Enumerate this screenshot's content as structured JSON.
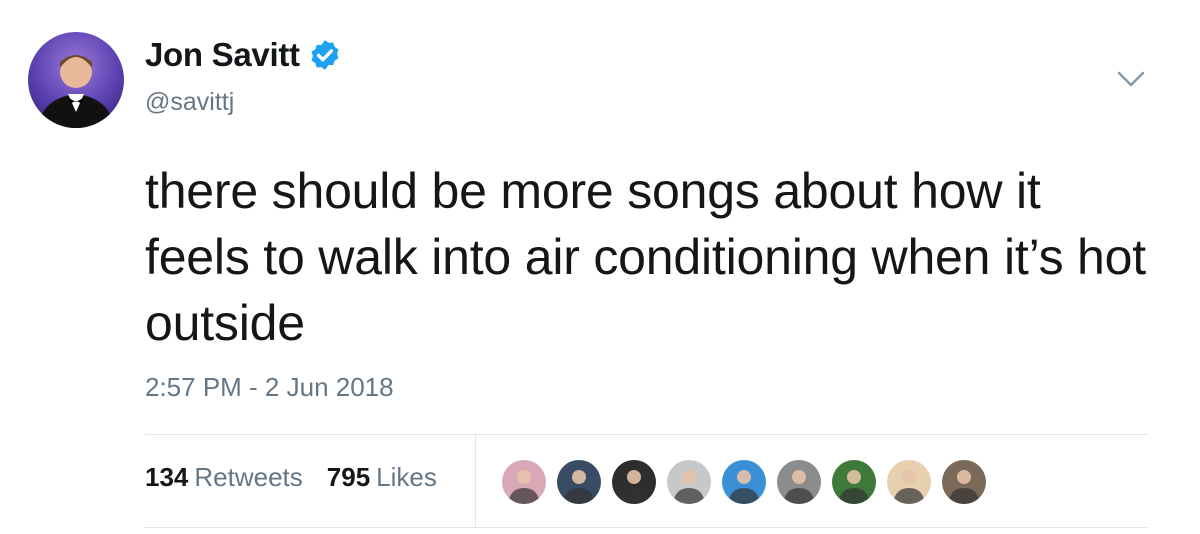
{
  "author": {
    "display_name": "Jon Savitt",
    "handle": "@savittj",
    "verified": true,
    "avatar": "avatar-tuxedo-photo"
  },
  "tweet": {
    "text": "there should be more songs about how it feels to walk into air conditioning when it’s hot outside",
    "timestamp": "2:57 PM - 2 Jun 2018"
  },
  "stats": {
    "retweets_count": "134",
    "retweets_label": "Retweets",
    "likes_count": "795",
    "likes_label": "Likes"
  },
  "likers": [
    {
      "icon": "liker-avatar",
      "color": "#d9a9b8"
    },
    {
      "icon": "liker-avatar",
      "color": "#3a4b66"
    },
    {
      "icon": "liker-avatar",
      "color": "#2e2e2e"
    },
    {
      "icon": "liker-avatar",
      "color": "#c8c8c8"
    },
    {
      "icon": "liker-avatar",
      "color": "#3a8fd6"
    },
    {
      "icon": "liker-avatar",
      "color": "#8c8c8c"
    },
    {
      "icon": "liker-avatar",
      "color": "#3f7a3a"
    },
    {
      "icon": "liker-avatar",
      "color": "#e6d0b0"
    },
    {
      "icon": "liker-avatar",
      "color": "#7b6a5a"
    }
  ],
  "colors": {
    "verified_badge": "#1da1f2",
    "secondary_text": "#657786",
    "primary_text": "#14171a"
  }
}
